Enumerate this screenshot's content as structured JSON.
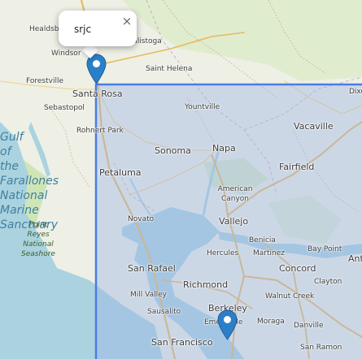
{
  "map": {
    "popup": {
      "text": "srjc",
      "close_symbol": "×"
    },
    "markers": [
      {
        "name": "marker-santa-rosa",
        "label_ref": "srjc"
      },
      {
        "name": "marker-berkeley"
      }
    ],
    "colors": {
      "land": "#eef0e6",
      "water": "#aad3df",
      "selection_fill": "#9db4e8",
      "selection_stroke": "#4a7de2",
      "marker": "#2b7fc8"
    },
    "place_labels": [
      "Healdsburg",
      "Windsor",
      "Calistoga",
      "Saint Helena",
      "Forestville",
      "Santa Rosa",
      "Sebastopol",
      "Rohnert Park",
      "Yountville",
      "Dixon",
      "Vacaville",
      "Sonoma",
      "Napa",
      "Petaluma",
      "Fairfield",
      "American Canyon",
      "Novato",
      "Vallejo",
      "Benicia",
      "Hercules",
      "Martinez",
      "Bay Point",
      "San Rafael",
      "Concord",
      "Antioch",
      "Richmond",
      "Mill Valley",
      "Clayton",
      "Walnut Creek",
      "Sausalito",
      "Berkeley",
      "Emeryville",
      "Moraga",
      "Danville",
      "San Francisco",
      "San Ramon"
    ],
    "water_labels": [
      "Gulf of the Farallones National Marine Sanctuary"
    ],
    "park_labels": [
      "Point Reyes National Seashore"
    ]
  }
}
